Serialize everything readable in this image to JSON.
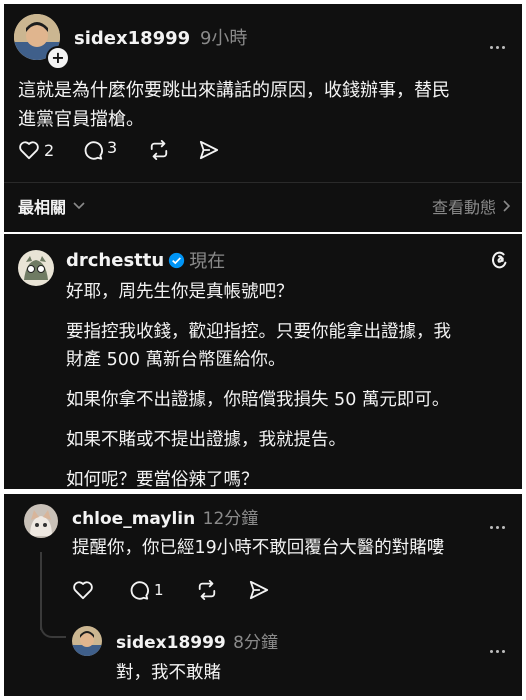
{
  "post": {
    "username": "sidex18999",
    "time": "9小時",
    "text_line1": "這就是為什麼你要跳出來講話的原因，收錢辦事，替民",
    "text_line2": "進黨官員擋槍。",
    "likes": "2",
    "comments": "3"
  },
  "sort": {
    "label": "最相關",
    "view_activity": "查看動態"
  },
  "reply": {
    "username": "drchesttu",
    "time": "現在",
    "lines": [
      "好耶，周先生你是真帳號吧？",
      "要指控我收錢，歡迎指控。只要你能拿出證據，我",
      "財產 500 萬新台幣匯給你。",
      "如果你拿不出證據，你賠償我損失 50 萬元即可。",
      "如果不賭或不提出證據，我就提告。",
      "如何呢？要當俗辣了嗎？"
    ]
  },
  "comment1": {
    "username": "chloe_maylin",
    "time": "12分鐘",
    "text": "提醒你，你已經19小時不敢回覆台大醫的對賭嘍",
    "comments": "1"
  },
  "comment2": {
    "username": "sidex18999",
    "time": "8分鐘",
    "text": "對，我不敢賭"
  },
  "colors": {
    "background": "#101010",
    "verified": "#0095f6"
  }
}
